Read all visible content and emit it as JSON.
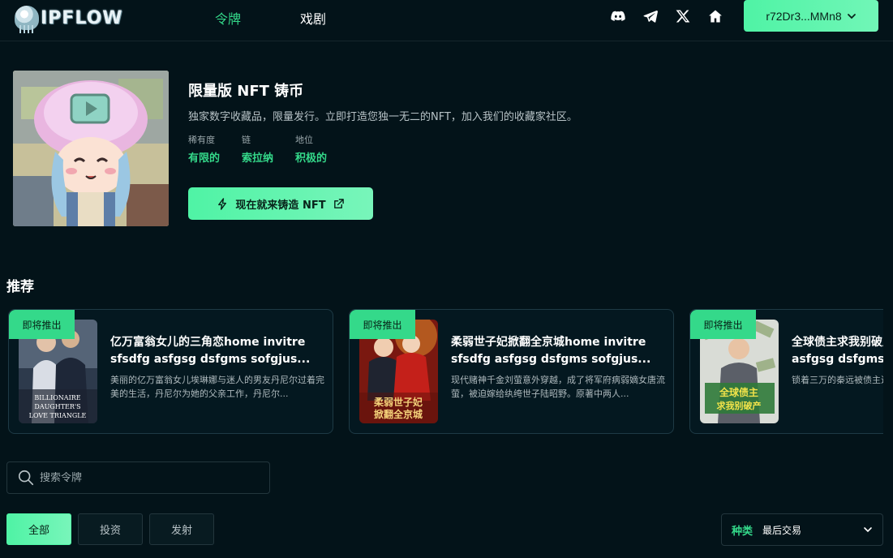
{
  "brand": {
    "name": "IPFLOW"
  },
  "nav": {
    "tabs": [
      "令牌",
      "戏剧"
    ]
  },
  "wallet": {
    "label": "r72Dr3...MMn8"
  },
  "icons": [
    "discord-icon",
    "telegram-icon",
    "x-icon",
    "home-icon"
  ],
  "hero": {
    "title": "限量版 NFT 铸币",
    "description": "独家数字收藏品，限量发行。立即打造您独一无二的NFT，加入我们的收藏家社区。",
    "stats": [
      {
        "label": "稀有度",
        "value": "有限的"
      },
      {
        "label": "链",
        "value": "索拉纳"
      },
      {
        "label": "地位",
        "value": "积极的"
      }
    ],
    "mint_label": "现在就来铸造 NFT"
  },
  "recommended": {
    "title": "推荐",
    "cards": [
      {
        "badge": "即将推出",
        "title_line1": "亿万富翁女儿的三角恋home invitre",
        "title_line2": "sfsdfg asfgsg dsfgms sofgjus...",
        "desc": "美丽的亿万富翁女儿埃琳娜与迷人的男友丹尼尔过着完美的生活，丹尼尔为她的父亲工作，丹尼尔...",
        "poster_text": [
          "BILLIONAIRE",
          "DAUGHTER'S",
          "LOVE TRIANGLE"
        ]
      },
      {
        "badge": "即将推出",
        "title_line1": "柔弱世子妃掀翻全京城home invitre",
        "title_line2": "sfsdfg asfgsg dsfgms sofgjus...",
        "desc": "现代赌神千金刘萤意外穿越，成了将军府病弱嫡女唐流萤，被迫嫁给纨绔世子陆昭野。原著中两人...",
        "poster_text": [
          "柔弱世子妃",
          "掀翻全京城"
        ]
      },
      {
        "badge": "即将推出",
        "title_line1": "全球债主求我别破产home invitre",
        "title_line2": "asfgsg dsfgms sofgjus...",
        "desc": "锁着三万的秦远被债主追到了持有三万亿的秦远...",
        "poster_text": [
          "全球债主",
          "求我别破产"
        ]
      }
    ]
  },
  "search": {
    "placeholder": "搜索令牌"
  },
  "filters": [
    "全部",
    "投资",
    "发射"
  ],
  "sort": {
    "label": "种类",
    "value": "最后交易"
  },
  "colors": {
    "background": "#031319",
    "accent": "#34d98a",
    "button_gradient_start": "#4ff3a5",
    "button_gradient_end": "#78f5ba"
  }
}
